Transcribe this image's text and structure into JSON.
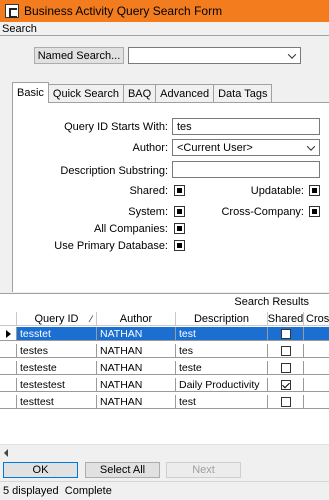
{
  "window": {
    "title": "Business Activity Query Search Form"
  },
  "search_group": {
    "label": "Search"
  },
  "named_search": {
    "button_label": "Named Search...",
    "value": ""
  },
  "tabs": [
    {
      "label": "Basic",
      "active": true
    },
    {
      "label": "Quick Search",
      "active": false
    },
    {
      "label": "BAQ",
      "active": false
    },
    {
      "label": "Advanced",
      "active": false
    },
    {
      "label": "Data Tags",
      "active": false
    }
  ],
  "basic": {
    "query_id_label": "Query ID Starts With:",
    "query_id_value": "tes",
    "author_label": "Author:",
    "author_value": "<Current User>",
    "description_label": "Description Substring:",
    "description_value": "",
    "shared_label": "Shared:",
    "updatable_label": "Updatable:",
    "system_label": "System:",
    "cross_company_label": "Cross-Company:",
    "all_companies_label": "All Companies:",
    "primary_db_label": "Use Primary Database:"
  },
  "results": {
    "caption": "Search Results",
    "columns": [
      "Query ID",
      "Author",
      "Description",
      "Shared",
      "Cross"
    ],
    "rows": [
      {
        "query_id": "tesstet",
        "author": "NATHAN",
        "description": "test",
        "shared": false,
        "selected": true
      },
      {
        "query_id": "testes",
        "author": "NATHAN",
        "description": "tes",
        "shared": false,
        "selected": false
      },
      {
        "query_id": "testeste",
        "author": "NATHAN",
        "description": "teste",
        "shared": false,
        "selected": false
      },
      {
        "query_id": "testestest",
        "author": "NATHAN",
        "description": "Daily Productivity",
        "shared": true,
        "selected": false
      },
      {
        "query_id": "testtest",
        "author": "NATHAN",
        "description": "test",
        "shared": false,
        "selected": false
      }
    ]
  },
  "buttons": {
    "ok": "OK",
    "select_all": "Select All",
    "next": "Next"
  },
  "status": {
    "text": "5 displayed  Complete"
  },
  "colors": {
    "titlebar": "#f27c1e",
    "selection": "#1a6fd1"
  },
  "icons": {
    "app": "app-logo-icon",
    "dropdown": "chevron-down-icon",
    "row_pointer": "row-pointer-icon",
    "scroll_left": "chevron-left-icon"
  }
}
